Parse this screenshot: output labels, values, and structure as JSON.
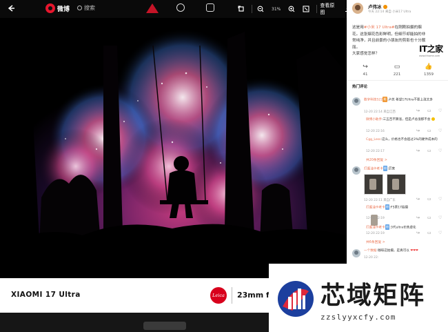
{
  "topbar": {
    "site_name": "微博",
    "search_placeholder": "搜索",
    "zoom": "31%",
    "original_label": "查看原图"
  },
  "bottombar": {
    "brand": "XIAOMI 17 Ultra",
    "leica": "Leica",
    "lens": "23mm  f/"
  },
  "panel": {
    "user": "卢伟冰",
    "user_meta": "今天 22:14 来自 小米17 Ultra",
    "post_pre": "这是用",
    "post_link": "#小米 17 Ultra#",
    "post_body": "在刚刚拍摄的烟花。这张烟花色彩鲜明，但细节却能拍的非常纯净，并且前景的小朋友的剪影也十分靓丽。",
    "question": "大家感觉怎样？",
    "it_logo": "IT之家",
    "it_url": "www.ithome.com",
    "actions": [
      {
        "icon": "↪",
        "count": "41"
      },
      {
        "icon": "▭",
        "count": "221"
      },
      {
        "icon": "👍",
        "count": "1359"
      }
    ],
    "section": "热门评论",
    "comments": [
      {
        "name": "数字科技522",
        "text": ":卢总 希望17Ultra不要上涨太多",
        "time": "12-20 22:14 来自江西"
      },
      {
        "name": "微博小助手",
        "text": ":三五百不算涨，但是卢总涨那不会",
        "time": "12-20 22:16"
      },
      {
        "name": "Cgg_Less",
        "text": ":这么，价格也不会超过3%的硬件成本的",
        "time": "12-20 22:17"
      },
      {
        "more": "共20条回复 >"
      },
      {
        "name": "打酱油卡老卡",
        "text": ":厉害",
        "time": "12-20 22:11 来自广东"
      },
      {
        "name": "打酱油卡老卡",
        "text": ":F5票17拍摄",
        "time": "12-20 22:19"
      },
      {
        "name": "打酱油卡老卡",
        "text": ":3代ultra长焦虚化",
        "time": "12-20 22:19"
      },
      {
        "more": "共6条回复 >"
      },
      {
        "name": "一个数据",
        "text": ":咖啡这拍摄，是真可以",
        "time": "12-20 22:"
      }
    ]
  },
  "watermark": {
    "title": "芯域矩阵",
    "url": "zzslyyxcfy.com"
  }
}
